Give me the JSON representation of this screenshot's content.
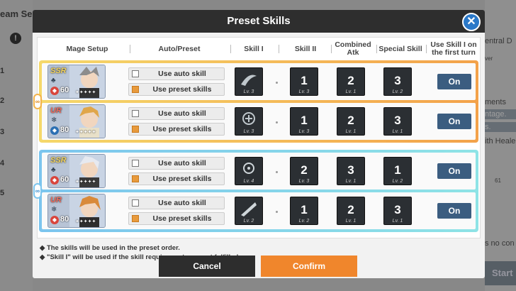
{
  "background": {
    "left_header": "eam Se",
    "left_numbers": [
      "1",
      "2",
      "3",
      "4",
      "5"
    ],
    "right_texts": [
      "entral D",
      "ver",
      "ments",
      "ntage.",
      "s.",
      "ith Heale",
      "61",
      "s no con"
    ],
    "start_label": "Start"
  },
  "modal": {
    "title": "Preset Skills",
    "close_icon": "close-icon",
    "columns": {
      "mage_setup": "Mage Setup",
      "auto_preset": "Auto/Preset",
      "skill_1": "Skill I",
      "skill_2": "Skill II",
      "combined": "Combined Atk",
      "special": "Special Skill",
      "use_first": "Use Skill I on the first turn"
    },
    "options": {
      "auto": "Use auto skill",
      "preset": "Use preset skills"
    },
    "groups": [
      {
        "link_icon": "link-icon",
        "rows": [
          {
            "rank": "SSR",
            "rank_color": "#f4d45c",
            "level": "60",
            "badge_color": "#d9453c",
            "skill1_lv": "Lv. 3",
            "skill2_order": "1",
            "skill2_lv": "Lv. 3",
            "combined_order": "2",
            "combined_lv": "Lv. 1",
            "special_order": "3",
            "special_lv": "Lv. 2",
            "toggle": "On",
            "auto_checked": false,
            "preset_checked": true
          },
          {
            "rank": "UR",
            "rank_color": "#f06a5a",
            "level": "80",
            "badge_color": "#2b6fb3",
            "skill1_lv": "Lv. 3",
            "skill2_order": "1",
            "skill2_lv": "Lv. 3",
            "combined_order": "2",
            "combined_lv": "Lv. 1",
            "special_order": "3",
            "special_lv": "Lv. 1",
            "toggle": "On",
            "auto_checked": false,
            "preset_checked": true
          }
        ]
      },
      {
        "link_icon": "link-icon",
        "rows": [
          {
            "rank": "SSR",
            "rank_color": "#f4d45c",
            "level": "60",
            "badge_color": "#d9453c",
            "skill1_lv": "Lv. 4",
            "skill2_order": "2",
            "skill2_lv": "Lv. 3",
            "combined_order": "3",
            "combined_lv": "Lv. 1",
            "special_order": "1",
            "special_lv": "Lv. 2",
            "toggle": "On",
            "auto_checked": false,
            "preset_checked": true
          },
          {
            "rank": "UR",
            "rank_color": "#f06a5a",
            "level": "80",
            "badge_color": "#d9453c",
            "skill1_lv": "Lv. 2",
            "skill2_order": "1",
            "skill2_lv": "Lv. 2",
            "combined_order": "2",
            "combined_lv": "Lv. 1",
            "special_order": "3",
            "special_lv": "Lv. 1",
            "toggle": "On",
            "auto_checked": false,
            "preset_checked": true
          }
        ]
      }
    ],
    "notes": [
      "◆ The skills will be used in the preset order.",
      "◆ \"Skill I\" will be used if the skill requirements are not fulfilled."
    ],
    "cancel_label": "Cancel",
    "confirm_label": "Confirm"
  }
}
